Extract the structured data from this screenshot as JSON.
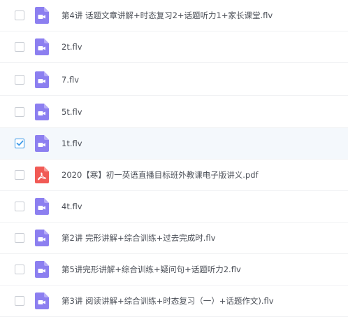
{
  "files": [
    {
      "name": "第4讲 话题文章讲解+时态复习2+话题听力1+家长课堂.flv",
      "type": "video",
      "checked": false
    },
    {
      "name": "2t.flv",
      "type": "video",
      "checked": false
    },
    {
      "name": "7.flv",
      "type": "video",
      "checked": false
    },
    {
      "name": "5t.flv",
      "type": "video",
      "checked": false
    },
    {
      "name": "1t.flv",
      "type": "video",
      "checked": true
    },
    {
      "name": "2020【寒】初一英语直播目标班外教课电子版讲义.pdf",
      "type": "pdf",
      "checked": false
    },
    {
      "name": "4t.flv",
      "type": "video",
      "checked": false
    },
    {
      "name": "第2讲 完形讲解+综合训练+过去完成时.flv",
      "type": "video",
      "checked": false
    },
    {
      "name": "第5讲完形讲解+综合训练+疑问句+话题听力2.flv",
      "type": "video",
      "checked": false
    },
    {
      "name": "第3讲 阅读讲解+综合训练+时态复习（一）+话题作文).flv",
      "type": "video",
      "checked": false
    }
  ],
  "icons": {
    "video": "video-file-icon",
    "pdf": "pdf-file-icon"
  },
  "colors": {
    "video_icon": "#8c7ff0",
    "pdf_icon": "#f15a55",
    "checkbox_checked": "#3d9ae8",
    "selected_row": "#f4f8fc",
    "text": "#4b4f57"
  }
}
